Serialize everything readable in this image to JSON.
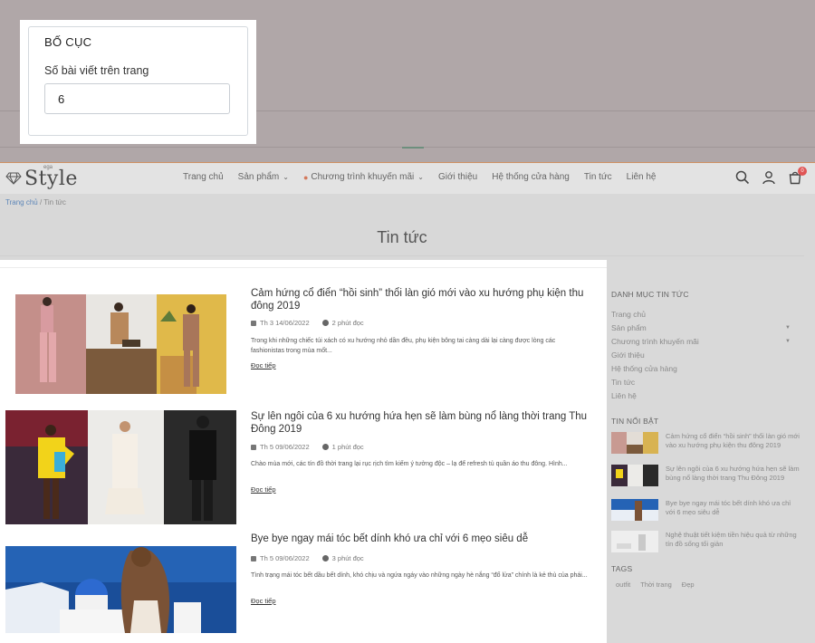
{
  "settings_panel": {
    "title": "BỐ CỤC",
    "posts_per_page_label": "Số bài viết trên trang",
    "posts_per_page_value": "6"
  },
  "header": {
    "logo_text": "Style",
    "logo_small": "ega",
    "nav": [
      {
        "label": "Trang chủ",
        "has_dropdown": false
      },
      {
        "label": "Sản phẩm",
        "has_dropdown": true
      },
      {
        "label": "Chương trình khuyến mãi",
        "has_dropdown": true
      },
      {
        "label": "Giới thiệu",
        "has_dropdown": false
      },
      {
        "label": "Hệ thống cửa hàng",
        "has_dropdown": false
      },
      {
        "label": "Tin tức",
        "has_dropdown": false
      },
      {
        "label": "Liên hệ",
        "has_dropdown": false
      }
    ],
    "cart_count": "0"
  },
  "breadcrumb": {
    "home": "Trang chủ",
    "separator": "/",
    "current": "Tin tức"
  },
  "page_title": "Tin tức",
  "articles": [
    {
      "title": "Cảm hứng cổ điển “hồi sinh” thổi làn gió mới vào xu hướng phụ kiện thu đông 2019",
      "date": "Th 3 14/06/2022",
      "read_time": "2 phút đọc",
      "excerpt": "Trong khi những chiếc túi xách có xu hướng nhỏ dần đều, phụ kiện bông tai càng dài lại càng được lòng các fashionistas trong mùa mốt...",
      "read_more": "Đọc tiếp"
    },
    {
      "title": "Sự lên ngôi của 6 xu hướng hứa hẹn sẽ làm bùng nổ làng thời trang Thu Đông 2019",
      "date": "Th 5 09/06/2022",
      "read_time": "1 phút đọc",
      "excerpt": "Chào mùa mới, các tín đồ thời trang lại rục rịch tìm kiếm ý tưởng độc – lạ để refresh tủ quần áo thu đông. Hình...",
      "read_more": "Đọc tiếp"
    },
    {
      "title": "Bye bye ngay mái tóc bết dính khó ưa chỉ với 6 mẹo siêu dễ",
      "date": "Th 5 09/06/2022",
      "read_time": "3 phút đọc",
      "excerpt": "Tình trạng mái tóc bết dầu bết dính, khó chịu và ngứa ngáy vào những ngày hè nắng “đổ lửa” chính là kẻ thù của phái...",
      "read_more": "Đọc tiếp"
    }
  ],
  "sidebar": {
    "categories_title": "DANH MỤC TIN TỨC",
    "categories": [
      {
        "label": "Trang chủ",
        "expandable": false
      },
      {
        "label": "Sản phẩm",
        "expandable": true
      },
      {
        "label": "Chương trình khuyến mãi",
        "expandable": true
      },
      {
        "label": "Giới thiệu",
        "expandable": false
      },
      {
        "label": "Hệ thống cửa hàng",
        "expandable": false
      },
      {
        "label": "Tin tức",
        "expandable": false
      },
      {
        "label": "Liên hệ",
        "expandable": false
      }
    ],
    "featured_title": "TIN NỔI BẬT",
    "featured": [
      {
        "title": "Cảm hứng cổ điển “hồi sinh” thổi làn gió mới vào xu hướng phụ kiện thu đông 2019"
      },
      {
        "title": "Sự lên ngôi của 6 xu hướng hứa hẹn sẽ làm bùng nổ làng thời trang Thu Đông 2019"
      },
      {
        "title": "Bye bye ngay mái tóc bết dính khó ưa chỉ với 6 mẹo siêu dễ"
      },
      {
        "title": "Nghệ thuật tiết kiệm tiền hiệu quả từ những tín đồ sống tối giản"
      }
    ],
    "tags_title": "TAGS",
    "tags": [
      "outfit",
      "Thời trang",
      "Đẹp"
    ]
  }
}
